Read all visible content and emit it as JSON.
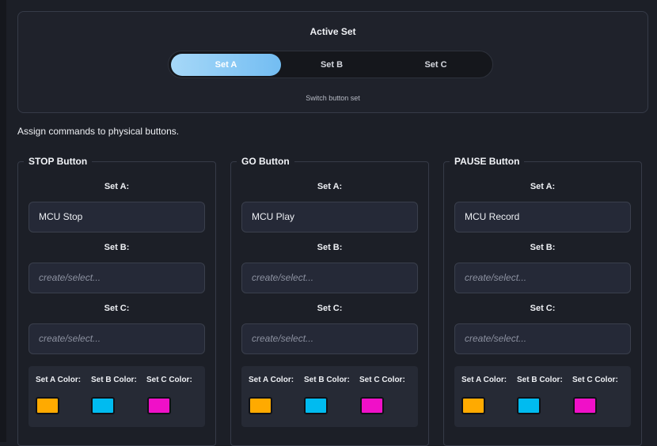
{
  "active_set": {
    "title": "Active Set",
    "options": [
      "Set A",
      "Set B",
      "Set C"
    ],
    "selected": "Set A",
    "hint": "Switch button set"
  },
  "intro": "Assign commands to physical buttons.",
  "set_labels": {
    "a": "Set A:",
    "b": "Set B:",
    "c": "Set C:"
  },
  "color_labels": {
    "a": "Set A Color:",
    "b": "Set B Color:",
    "c": "Set C Color:"
  },
  "colors": {
    "a": "#ffaa00",
    "b": "#00bbf0",
    "c": "#f010c8"
  },
  "placeholder": "create/select...",
  "groups": [
    {
      "title": "STOP Button",
      "set_a": "MCU Stop",
      "set_b": "",
      "set_c": ""
    },
    {
      "title": "GO Button",
      "set_a": "MCU Play",
      "set_b": "",
      "set_c": ""
    },
    {
      "title": "PAUSE Button",
      "set_a": "MCU Record",
      "set_b": "",
      "set_c": ""
    }
  ]
}
